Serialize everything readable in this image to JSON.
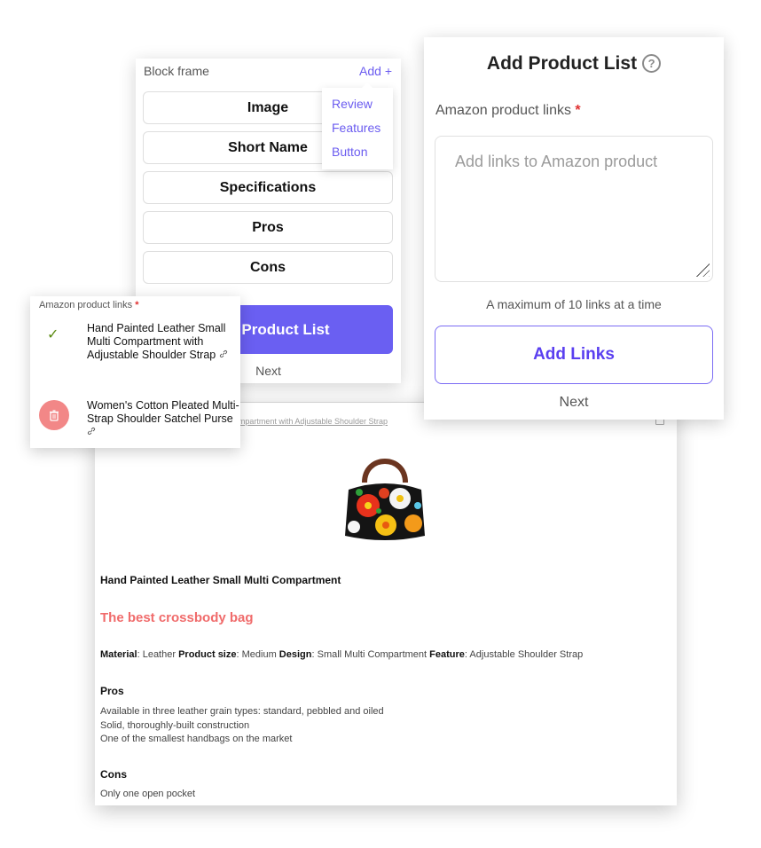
{
  "preview": {
    "link_text": "Hand Painted Leather Small Multi Compartment with Adjustable Shoulder Strap",
    "product_title": "Hand Painted Leather Small Multi Compartment",
    "tagline": "The best crossbody bag",
    "tagline_color": "#f06b6b",
    "specs": [
      {
        "key": "Material",
        "value": "Leather"
      },
      {
        "key": "Product size",
        "value": "Medium"
      },
      {
        "key": "Design",
        "value": "Small Multi Compartment"
      },
      {
        "key": "Feature",
        "value": "Adjustable Shoulder Strap"
      }
    ],
    "pros_heading": "Pros",
    "pros": [
      "Available in three leather grain types: standard, pebbled and oiled",
      "Solid, thoroughly-built construction",
      "One of the smallest handbags on the market"
    ],
    "cons_heading": "Cons",
    "cons": [
      "Only one open pocket"
    ],
    "image_icon": "product-image-floral-handbag"
  },
  "block_frame": {
    "title": "Block frame",
    "add_label": "Add +",
    "items": [
      "Image",
      "Short Name",
      "Specifications",
      "Pros",
      "Cons"
    ],
    "primary_button": "Add Product List",
    "primary_button_visible": "Product List",
    "next_label": "Next",
    "accent_color": "#6a5ff2"
  },
  "add_menu": {
    "items": [
      "Review",
      "Features",
      "Button"
    ]
  },
  "add_product_list": {
    "title": "Add Product List",
    "help_icon": "question-circle-icon",
    "field_label": "Amazon product links",
    "required_mark": "*",
    "textarea_placeholder": "Add links to Amazon product",
    "textarea_value": "",
    "hint": "A maximum of 10 links at a time",
    "add_links_button": "Add Links",
    "next_label": "Next"
  },
  "links_card": {
    "label": "Amazon product links",
    "required_mark": "*",
    "items": [
      {
        "title": "Hand Painted Leather Small Multi Compartment with Adjustable Shoulder Strap",
        "status": "check-icon"
      },
      {
        "title": "Women's Cotton Pleated Multi-Strap Shoulder Satchel Purse",
        "status": "delete-icon"
      }
    ],
    "link_glyph": "🔗"
  }
}
